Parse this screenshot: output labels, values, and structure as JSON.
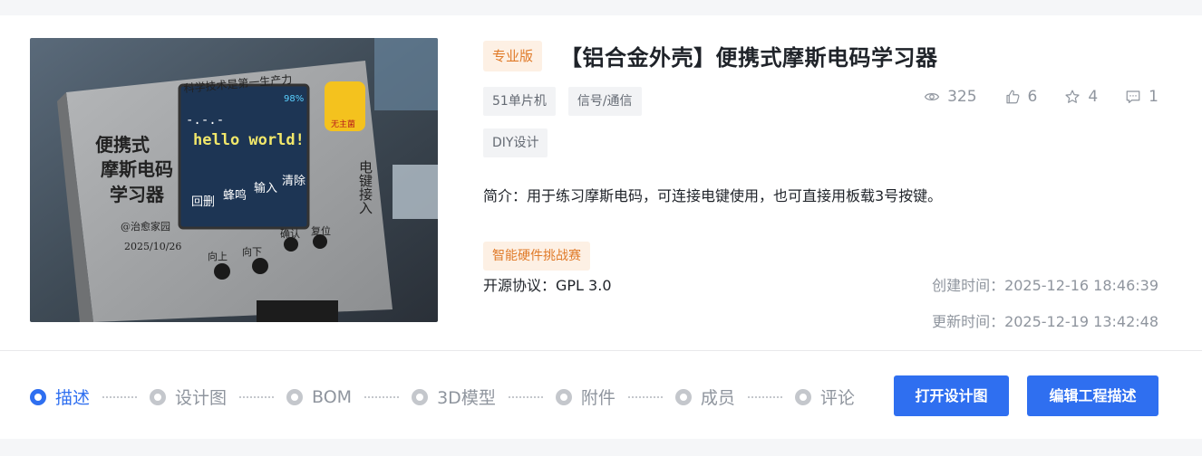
{
  "project": {
    "edition_badge": "专业版",
    "title": "【铝合金外壳】便携式摩斯电码学习器",
    "tags": [
      "51单片机",
      "信号/通信",
      "DIY设计"
    ],
    "stats": {
      "views": "325",
      "likes": "6",
      "favorites": "4",
      "comments": "1"
    },
    "description": "简介：用于练习摩斯电码，可连接电键使用，也可直接用板载3号按键。",
    "event_tag": "智能硬件挑战赛",
    "license": "开源协议：GPL 3.0",
    "created": "创建时间：2025-12-16 18:46:39",
    "updated": "更新时间：2025-12-19 13:42:48"
  },
  "cover": {
    "top_text": "科学技术是第一生产力",
    "side_left": [
      "便携式",
      "摩斯电码",
      "学习器"
    ],
    "signature": "@治愈家园",
    "date": "2025/10/26",
    "screen_text": "hello world!",
    "screen_morse": "-.-.-",
    "screen_battery": "98%",
    "screen_menu": [
      "回删",
      "蜂鸣",
      "输入",
      "清除"
    ],
    "buttons_top": [
      "确认",
      "复位"
    ],
    "buttons_bottom": [
      "向上",
      "向下"
    ],
    "side_right": "电键接入",
    "mascot": "无主菌"
  },
  "nav": {
    "steps": [
      "描述",
      "设计图",
      "BOM",
      "3D模型",
      "附件",
      "成员",
      "评论"
    ],
    "active_step": "描述",
    "open_design_button": "打开设计图",
    "edit_desc_button": "编辑工程描述"
  },
  "colors": {
    "accent": "#2f6ff0",
    "badge_bg": "#fdf0e4",
    "badge_text": "#e07b2a",
    "device_case": "#9a9c9e",
    "screen": "#1d3554"
  }
}
